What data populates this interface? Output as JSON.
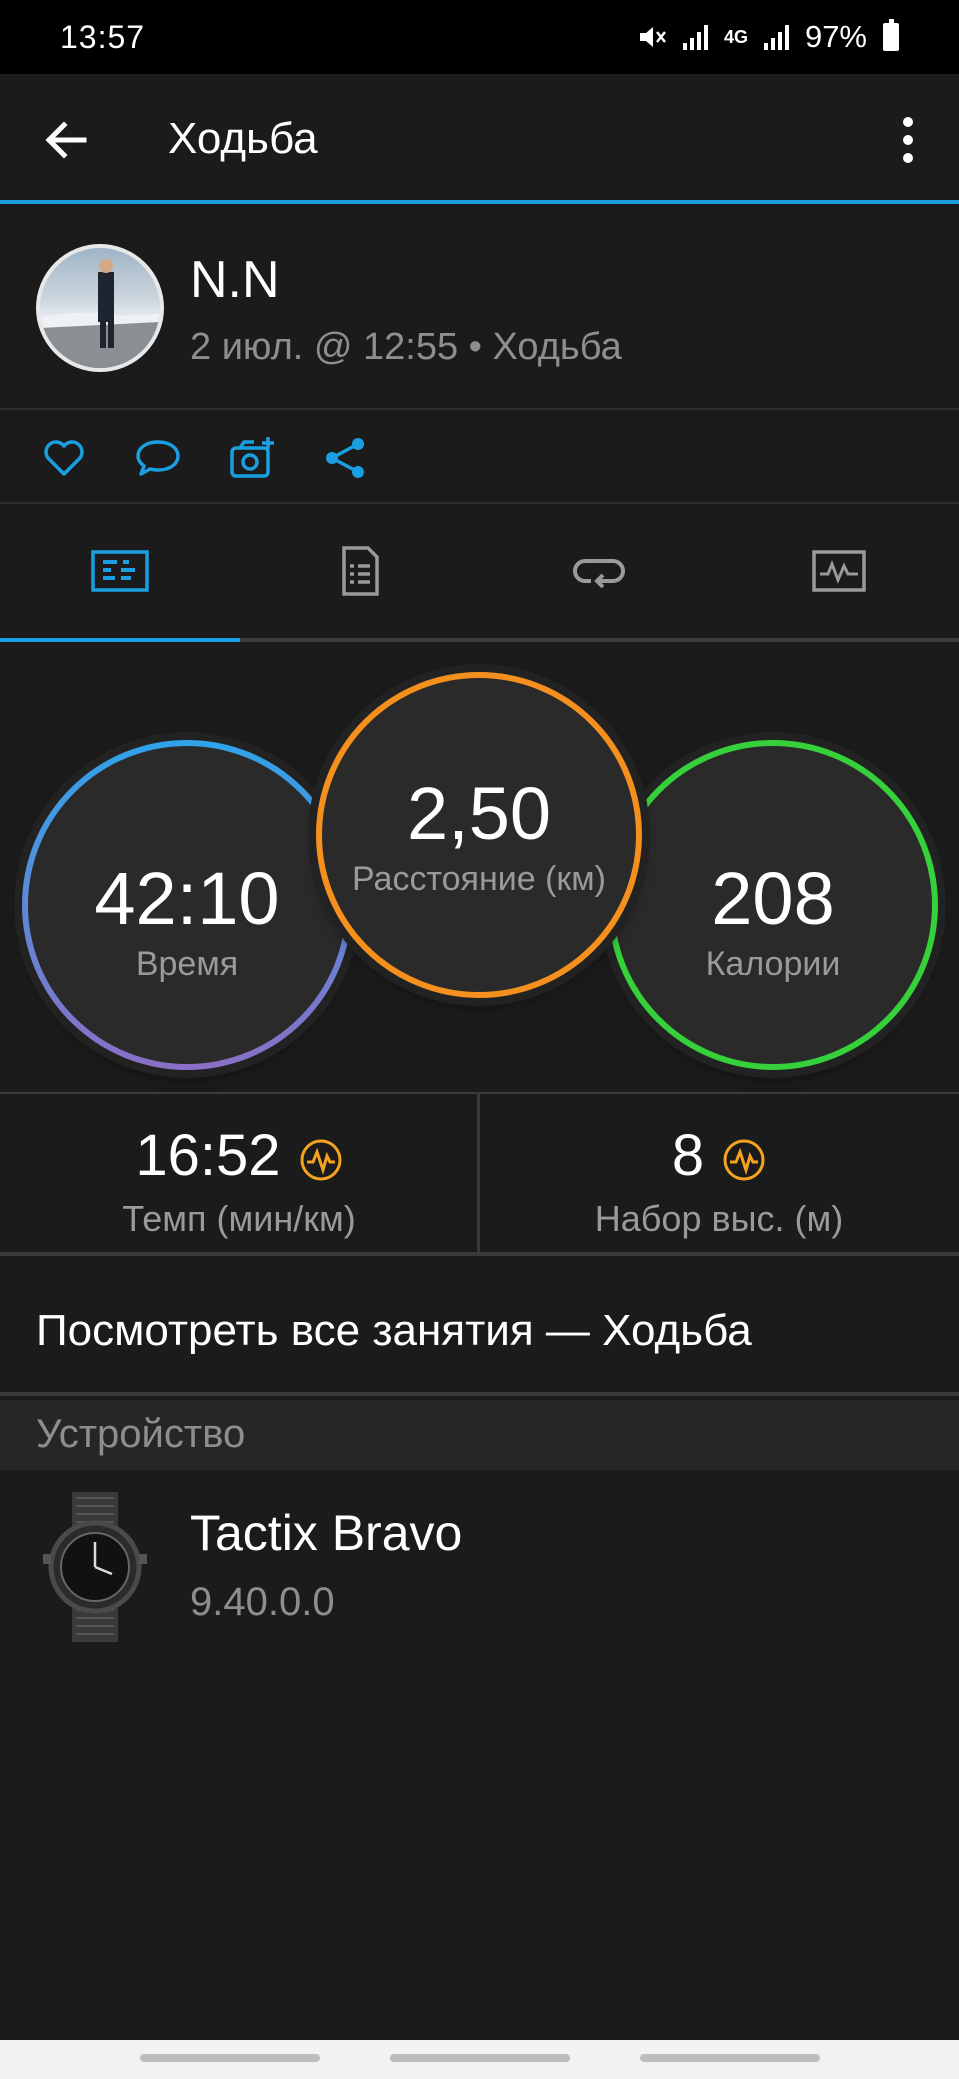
{
  "status_bar": {
    "time": "13:57",
    "network": "4G",
    "battery": "97%"
  },
  "app_bar": {
    "title": "Ходьба"
  },
  "profile": {
    "name": "N.N",
    "meta": "2 июл. @ 12:55 • Ходьба"
  },
  "social": {
    "icons": [
      "heart-icon",
      "comment-icon",
      "add-photo-icon",
      "share-icon"
    ]
  },
  "tabs": [
    {
      "icon": "stats-icon",
      "active": true
    },
    {
      "icon": "details-icon",
      "active": false
    },
    {
      "icon": "laps-icon",
      "active": false
    },
    {
      "icon": "chart-icon",
      "active": false
    }
  ],
  "stats": {
    "time": {
      "value": "42:10",
      "label": "Время",
      "color": "#2fa3ea",
      "color2": "#8a6fc6"
    },
    "distance": {
      "value": "2,50",
      "label": "Расстояние (км)",
      "color": "#f5901e"
    },
    "calories": {
      "value": "208",
      "label": "Калории",
      "color": "#36d03a"
    }
  },
  "metrics": {
    "pace": {
      "value": "16:52",
      "label": "Темп (мин/км)"
    },
    "elevation": {
      "value": "8",
      "label": "Набор выс. (м)"
    }
  },
  "view_all": "Посмотреть все занятия — Ходьба",
  "device_section": {
    "title": "Устройство"
  },
  "device": {
    "name": "Tactix Bravo",
    "version": "9.40.0.0"
  },
  "colors": {
    "accent": "#1a9fe0",
    "badge": "#f5a21e"
  }
}
